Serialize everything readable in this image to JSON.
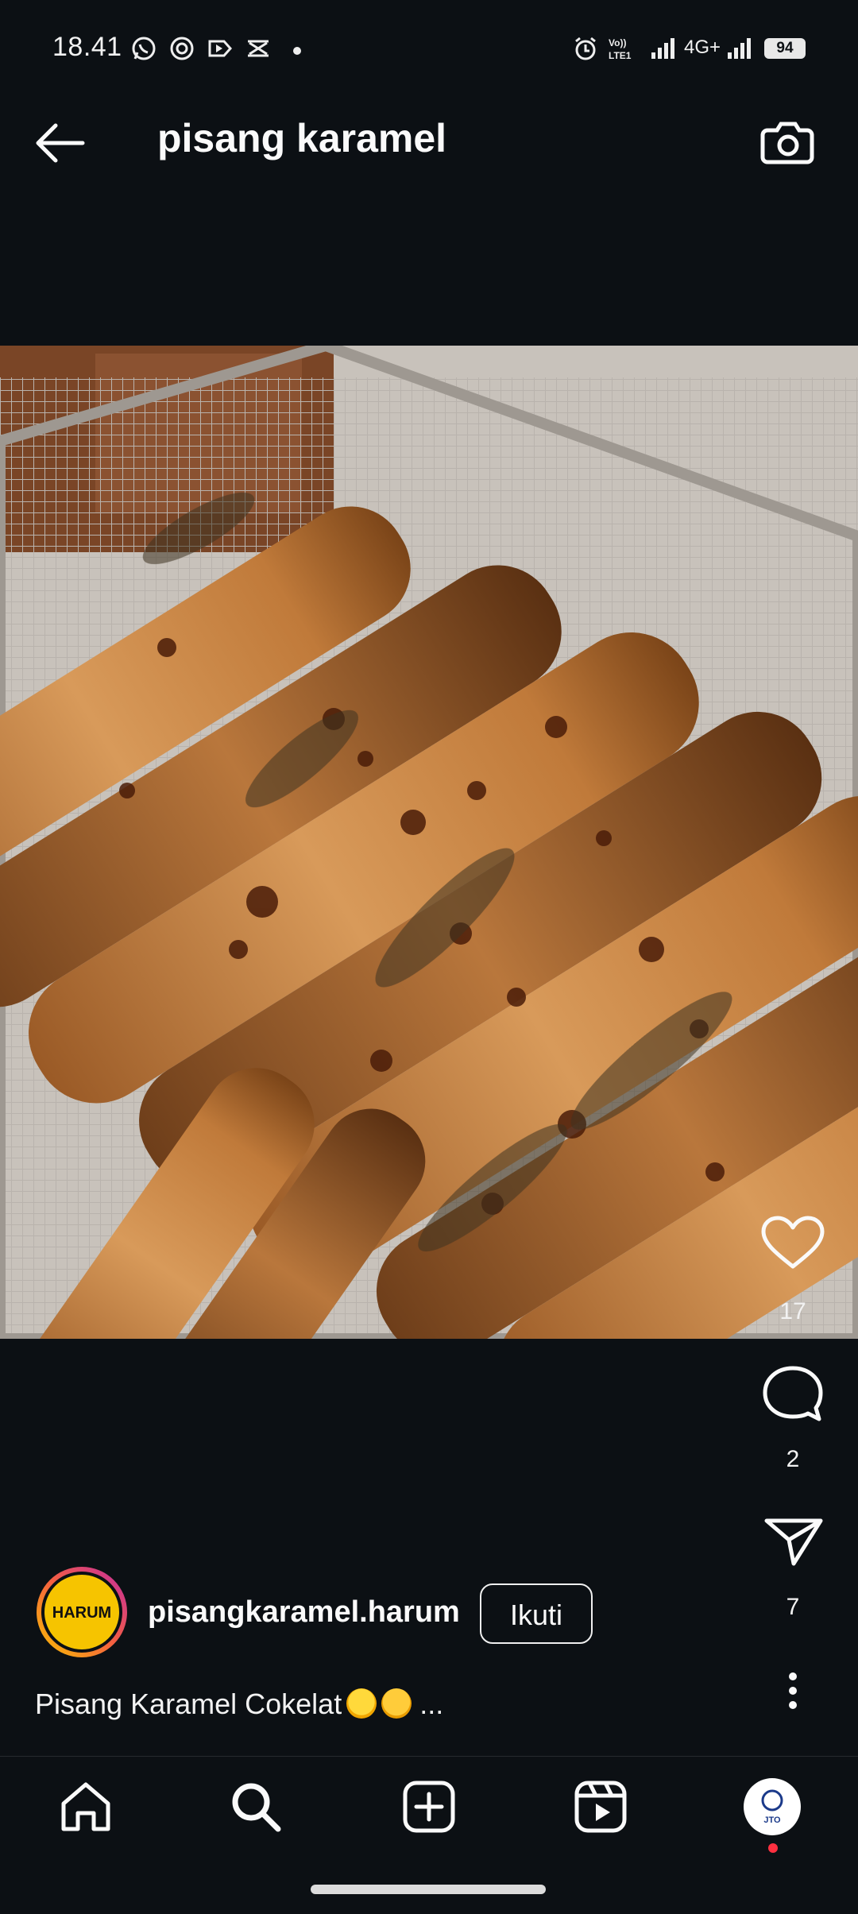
{
  "status_bar": {
    "time": "18.41",
    "network": "4G+",
    "battery": "94",
    "icons": [
      "whatsapp-icon",
      "signal-app-icon",
      "play-icon",
      "capcut-icon",
      "dot-icon",
      "alarm-icon",
      "volte-icon",
      "signal-icon",
      "signal-icon-2"
    ]
  },
  "header": {
    "title": "pisang karamel",
    "back_icon": "arrow-left-icon",
    "camera_icon": "camera-icon"
  },
  "post": {
    "image_alt": "caramel banana rolls on a wire rack",
    "likes": "17",
    "comments": "2",
    "shares": "7",
    "author": {
      "username": "pisangkaramel.harum",
      "avatar_text": "HARUM"
    },
    "follow_label": "Ikuti",
    "caption": "Pisang Karamel Cokelat",
    "caption_more": "..."
  },
  "bottom_nav": {
    "items": [
      "home-icon",
      "search-icon",
      "add-icon",
      "reels-icon",
      "profile-avatar"
    ],
    "profile_avatar_text": "JTO"
  },
  "colors": {
    "background": "#0c1014",
    "text": "#f5f5f5",
    "avatar_ring_start": "#f9c300",
    "avatar_ring_end": "#c32aa3",
    "notification_dot": "#ff3040"
  }
}
